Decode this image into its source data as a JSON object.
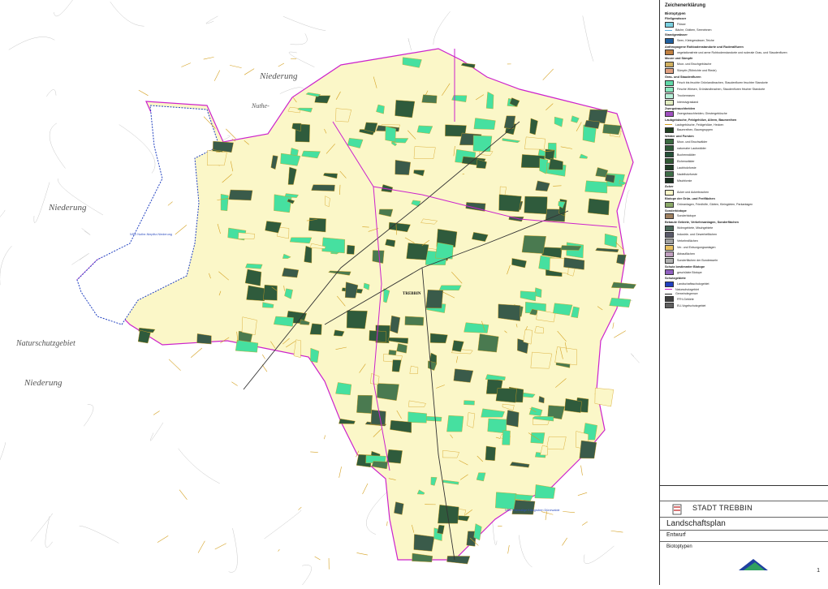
{
  "map": {
    "labels": {
      "niederung_top": "Niederung",
      "niederung_mid": "Niederung",
      "niederung_low": "Niederung",
      "naturschutzgebiet": "Naturschutzgebiet",
      "nuthe": "Nuthe-",
      "trebbin": "TREBBIN"
    },
    "blue_labels": {
      "nsg_nuthe": "NSG Nuthe-Nieplitz-Niederung",
      "nsg_kiesgrube": "NSG Ehemalige Kiesgruben Dünewalde"
    },
    "colors": {
      "field": "#fbf7c8",
      "meadow": "#46e0a0",
      "forest": "#2f5b3c",
      "forest_light": "#4a7a50",
      "settlement": "#3a5b4a",
      "hedge": "#d4a020",
      "boundary": "#cc22cc",
      "water": "#2040c0"
    }
  },
  "legend": {
    "title": "Zeichenerklärung",
    "subtitle": "Biotoptypen",
    "groups": [
      {
        "heading": "Fließgewässer",
        "items": [
          {
            "color": "#7ad0e0",
            "label": "Flüsse",
            "type": "box"
          },
          {
            "color": "#60b0e0",
            "label": "Bäche, Gräben, Seenrinnen",
            "type": "line"
          }
        ]
      },
      {
        "heading": "Standgewässer",
        "items": [
          {
            "color": "#2060a0",
            "label": "Seen, Kleingewässer, Teiche",
            "type": "box"
          }
        ]
      },
      {
        "heading": "Anthropogene Rohbodenstandorte und Ruderalfluren",
        "items": [
          {
            "color": "#c08040",
            "label": "vegetationsfreie und arme Rohbodenstandorte und ruderale Gras- und Staudenfluren",
            "type": "box"
          }
        ]
      },
      {
        "heading": "Moore und Sümpfe",
        "items": [
          {
            "color": "#d0b060",
            "label": "Moor- und Bruchgebüsche",
            "type": "box"
          },
          {
            "color": "#e0a080",
            "label": "Sümpfe (Röhrichte und Riede)",
            "type": "box"
          }
        ]
      },
      {
        "heading": "Gras- und Staudenfluren",
        "items": [
          {
            "color": "#60d8a8",
            "label": "Frisch bis feuchte Grünlandbrachen, Staudenfluren feuchter Standorte",
            "type": "box"
          },
          {
            "color": "#8ce8c0",
            "label": "Frische Wiesen, Grünlandbrachen, Staudenfluren frischer Standorte",
            "type": "box"
          },
          {
            "color": "#b8f0d8",
            "label": "Trockenrasen",
            "type": "box"
          },
          {
            "color": "#e0ecc0",
            "label": "Intensivgrasland",
            "type": "box"
          }
        ]
      },
      {
        "heading": "Zwergstrauchheiden",
        "items": [
          {
            "color": "#a050c0",
            "label": "Zwergstrauchheiden, Ginstergebüsche",
            "type": "box"
          }
        ]
      },
      {
        "heading": "Laubgebüsche, Feldgehölze, Alleen, Baumreihen",
        "items": [
          {
            "color": "#d4a020",
            "label": "Laubgebüsche, Feldgehölze, Hecken",
            "type": "line"
          },
          {
            "color": "#204020",
            "label": "Baumreihen, Baumgruppen",
            "type": "box"
          }
        ]
      },
      {
        "heading": "Wälder und Forsten",
        "items": [
          {
            "color": "#3a6a40",
            "label": "Moor- und Bruchwälder",
            "type": "box"
          },
          {
            "color": "#2e5a38",
            "label": "naturnahe Laubwälder",
            "type": "box"
          },
          {
            "color": "#26503a",
            "label": "Buchenwälder",
            "type": "box"
          },
          {
            "color": "#305a34",
            "label": "Eichenwälder",
            "type": "box"
          },
          {
            "color": "#203e28",
            "label": "Laubholzforste",
            "type": "box"
          },
          {
            "color": "#3e6e48",
            "label": "Nadelholzforste",
            "type": "box"
          },
          {
            "color": "#1a3020",
            "label": "Mischforste",
            "type": "box"
          }
        ]
      },
      {
        "heading": "Äcker",
        "items": [
          {
            "color": "#fbf7c8",
            "label": "Äcker und Ackerbrachen",
            "type": "box"
          }
        ]
      },
      {
        "heading": "Biotope der Grün- und Freiflächen",
        "items": [
          {
            "color": "#8aa868",
            "label": "Grünanlagen, Friedhöfe, Gärten, Kleingärten, Parkanlagen",
            "type": "box"
          }
        ]
      },
      {
        "heading": "Sonderbiotope",
        "items": [
          {
            "color": "#a08060",
            "label": "Sonderbiotope",
            "type": "box"
          }
        ]
      },
      {
        "heading": "Bebaute Gebiete, Verkehrsanlagen, Sonderflächen",
        "items": [
          {
            "color": "#4a6a5a",
            "label": "Wohngebiete, Mischgebiete",
            "type": "box"
          },
          {
            "color": "#5a5a6a",
            "label": "Industrie- und Gewerbeflächen",
            "type": "box"
          },
          {
            "color": "#a0a0a0",
            "label": "Verkehrsflächen",
            "type": "box"
          },
          {
            "color": "#e8c060",
            "label": "Ver- und Entsorgungsanlagen",
            "type": "box"
          },
          {
            "color": "#c0a0c0",
            "label": "Abbauflächen",
            "type": "box"
          },
          {
            "color": "#b0b0b0",
            "label": "Sonderflächen der Bundeswehr",
            "type": "box"
          }
        ]
      },
      {
        "heading": "Schutz bestimmter Biotope",
        "items": [
          {
            "color": "#9060c0",
            "label": "geschützte Biotope",
            "type": "box"
          }
        ]
      },
      {
        "heading": "Schutzgebiete",
        "items": [
          {
            "color": "#2040c0",
            "label": "Landschaftsschutzgebiet",
            "type": "box"
          },
          {
            "color": "#cc22cc",
            "label": "Naturschutzgebiet",
            "type": "line"
          },
          {
            "color": "#202020",
            "label": "Gemeindegrenze",
            "type": "line"
          },
          {
            "color": "#404040",
            "label": "FFH-Gebiete",
            "type": "box"
          },
          {
            "color": "#606060",
            "label": "EU-Vogelschutzgebiet",
            "type": "box"
          }
        ]
      }
    ]
  },
  "titleblock": {
    "city": "STADT TREBBIN",
    "plan": "Landschaftsplan",
    "stage": "Entwurf",
    "sheet_title": "Biotoptypen",
    "page_number": "1"
  }
}
